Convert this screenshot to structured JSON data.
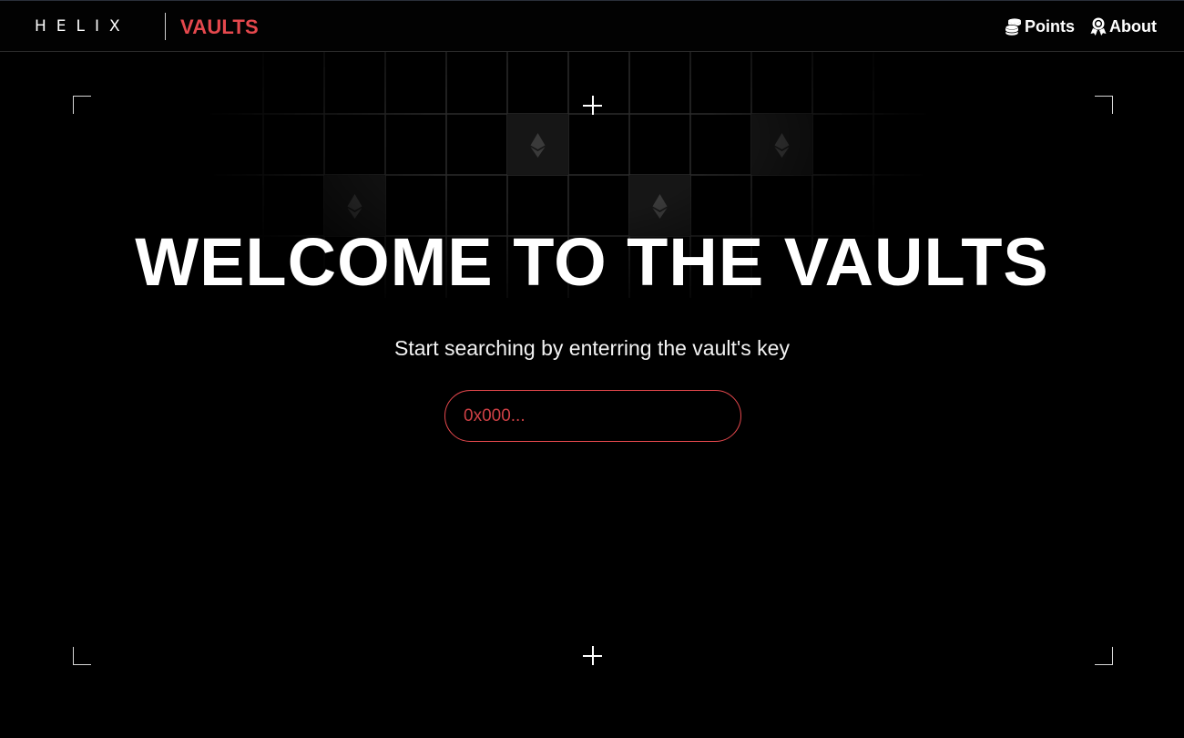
{
  "header": {
    "logo_text": "HELIX",
    "brand_label": "VAULTS",
    "nav": [
      {
        "label": "Points",
        "icon": "coins-icon"
      },
      {
        "label": "About",
        "icon": "award-ribbon-icon"
      }
    ]
  },
  "hero": {
    "title": "WELCOME TO THE VAULTS",
    "subtitle": "Start searching by enterring the vault's key"
  },
  "search": {
    "placeholder": "0x000...",
    "value": ""
  },
  "colors": {
    "accent": "#e5484d",
    "background": "#000000",
    "text": "#ffffff"
  },
  "decor": {
    "grid_icon": "ethereum-icon",
    "frame_marks": [
      "corner-bracket",
      "crosshair"
    ]
  }
}
